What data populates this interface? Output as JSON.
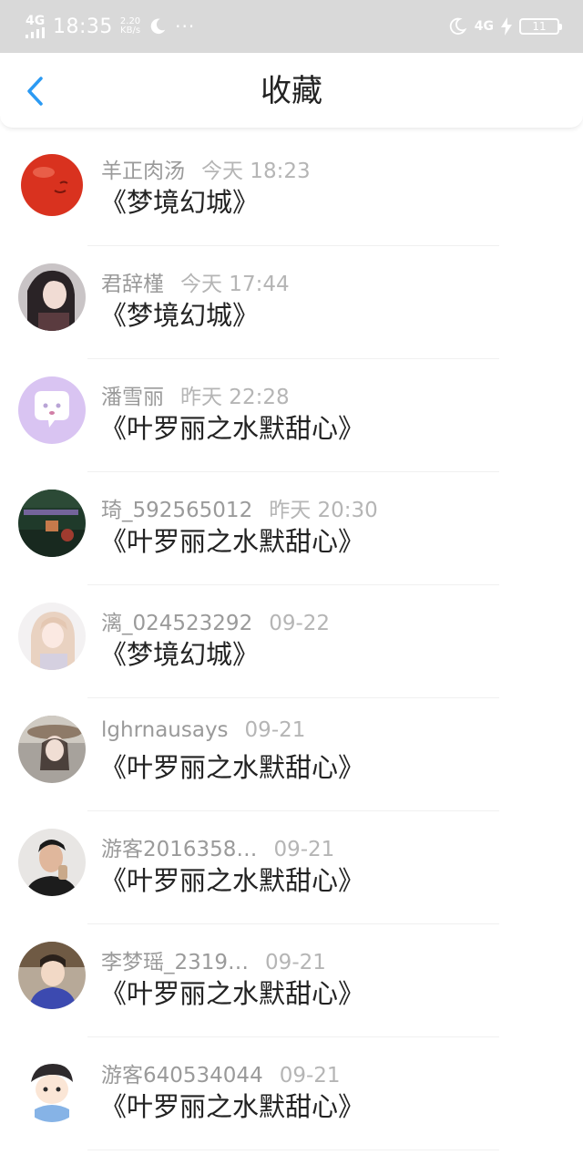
{
  "status_bar": {
    "network": "4G",
    "time": "18:35",
    "speed_value": "2.20",
    "speed_unit": "KB/s",
    "dots": "···",
    "network_right": "4G",
    "battery": "11"
  },
  "nav": {
    "title": "收藏",
    "back_icon": "chevron-left-icon",
    "accent_color": "#2b9af3"
  },
  "items": [
    {
      "name": "羊正肉汤",
      "time": "今天 18:23",
      "title": "《梦境幻城》",
      "avatar": "red-ball"
    },
    {
      "name": "君辞槿",
      "time": "今天 17:44",
      "title": "《梦境幻城》",
      "avatar": "anime-girl-dark"
    },
    {
      "name": "潘雪丽",
      "time": "昨天 22:28",
      "title": "《叶罗丽之水默甜心》",
      "avatar": "purple-chat-bubble"
    },
    {
      "name": "琦_592565012",
      "time": "昨天 20:30",
      "title": "《叶罗丽之水默甜心》",
      "avatar": "green-scene"
    },
    {
      "name": "漓_024523292",
      "time": "09-22",
      "title": "《梦境幻城》",
      "avatar": "anime-girl-light"
    },
    {
      "name": "lghrnausays",
      "time": "09-21",
      "title": "《叶罗丽之水默甜心》",
      "avatar": "girl-hat"
    },
    {
      "name": "游客2016358…",
      "time": "09-21",
      "title": "《叶罗丽之水默甜心》",
      "avatar": "man-photo"
    },
    {
      "name": "李梦瑶_2319…",
      "time": "09-21",
      "title": "《叶罗丽之水默甜心》",
      "avatar": "child-photo"
    },
    {
      "name": "游客640534044",
      "time": "09-21",
      "title": "《叶罗丽之水默甜心》",
      "avatar": "cartoon-boy"
    }
  ]
}
